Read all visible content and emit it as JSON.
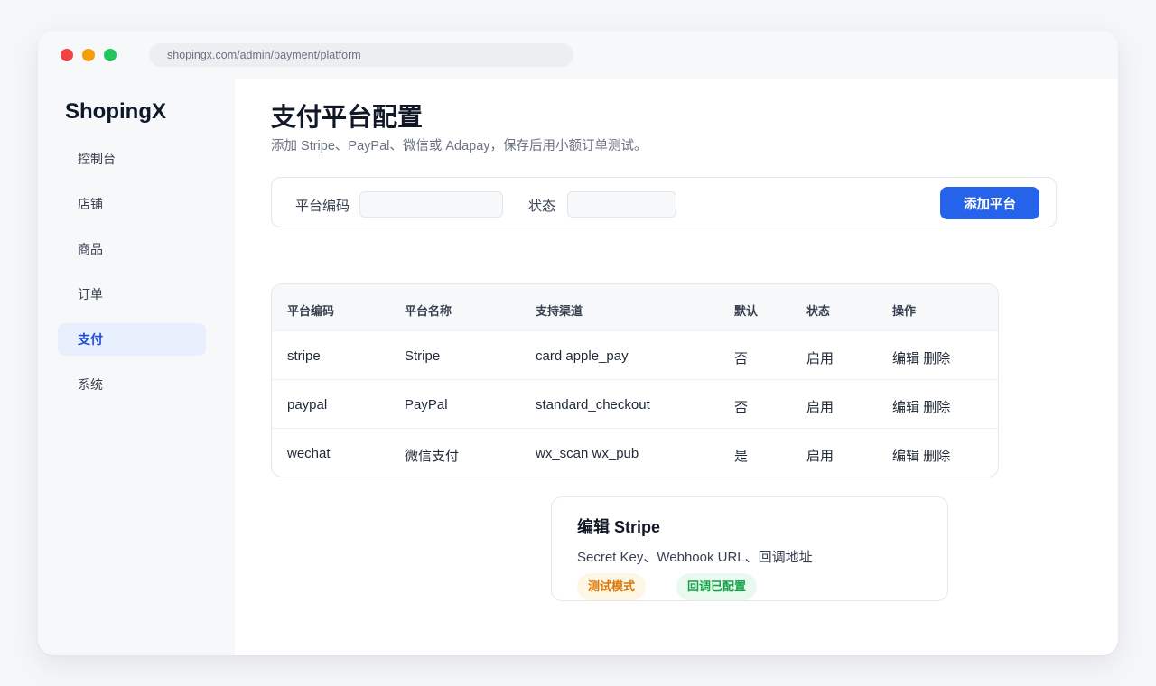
{
  "browser": {
    "url": "shopingx.com/admin/payment/platform"
  },
  "sidebar": {
    "brand": "ShopingX",
    "items": [
      {
        "label": "控制台"
      },
      {
        "label": "店铺"
      },
      {
        "label": "商品"
      },
      {
        "label": "订单"
      },
      {
        "label": "支付",
        "active": true
      },
      {
        "label": "系统"
      }
    ]
  },
  "page": {
    "title": "支付平台配置",
    "subtitle": "添加 Stripe、PayPal、微信或 Adapay，保存后用小额订单测试。"
  },
  "filter": {
    "code_label": "平台编码",
    "code_value": "",
    "status_label": "状态",
    "status_value": "",
    "add_button": "添加平台"
  },
  "table": {
    "headers": [
      "平台编码",
      "平台名称",
      "支持渠道",
      "默认",
      "状态",
      "操作"
    ],
    "rows": [
      {
        "code": "stripe",
        "name": "Stripe",
        "channels": "card apple_pay",
        "default": "否",
        "status": "启用",
        "edit": "编辑",
        "delete": "删除"
      },
      {
        "code": "paypal",
        "name": "PayPal",
        "channels": "standard_checkout",
        "default": "否",
        "status": "启用",
        "edit": "编辑",
        "delete": "删除"
      },
      {
        "code": "wechat",
        "name": "微信支付",
        "channels": "wx_scan wx_pub",
        "default": "是",
        "status": "启用",
        "edit": "编辑",
        "delete": "删除"
      }
    ]
  },
  "edit_card": {
    "title": "编辑 Stripe",
    "description": "Secret Key、Webhook URL、回调地址",
    "badge_mode": "测试模式",
    "badge_callback": "回调已配置"
  },
  "colors": {
    "accent": "#2563eb",
    "active_nav_bg": "#e9f0fd",
    "warning": "#d97706",
    "success": "#16a34a"
  }
}
